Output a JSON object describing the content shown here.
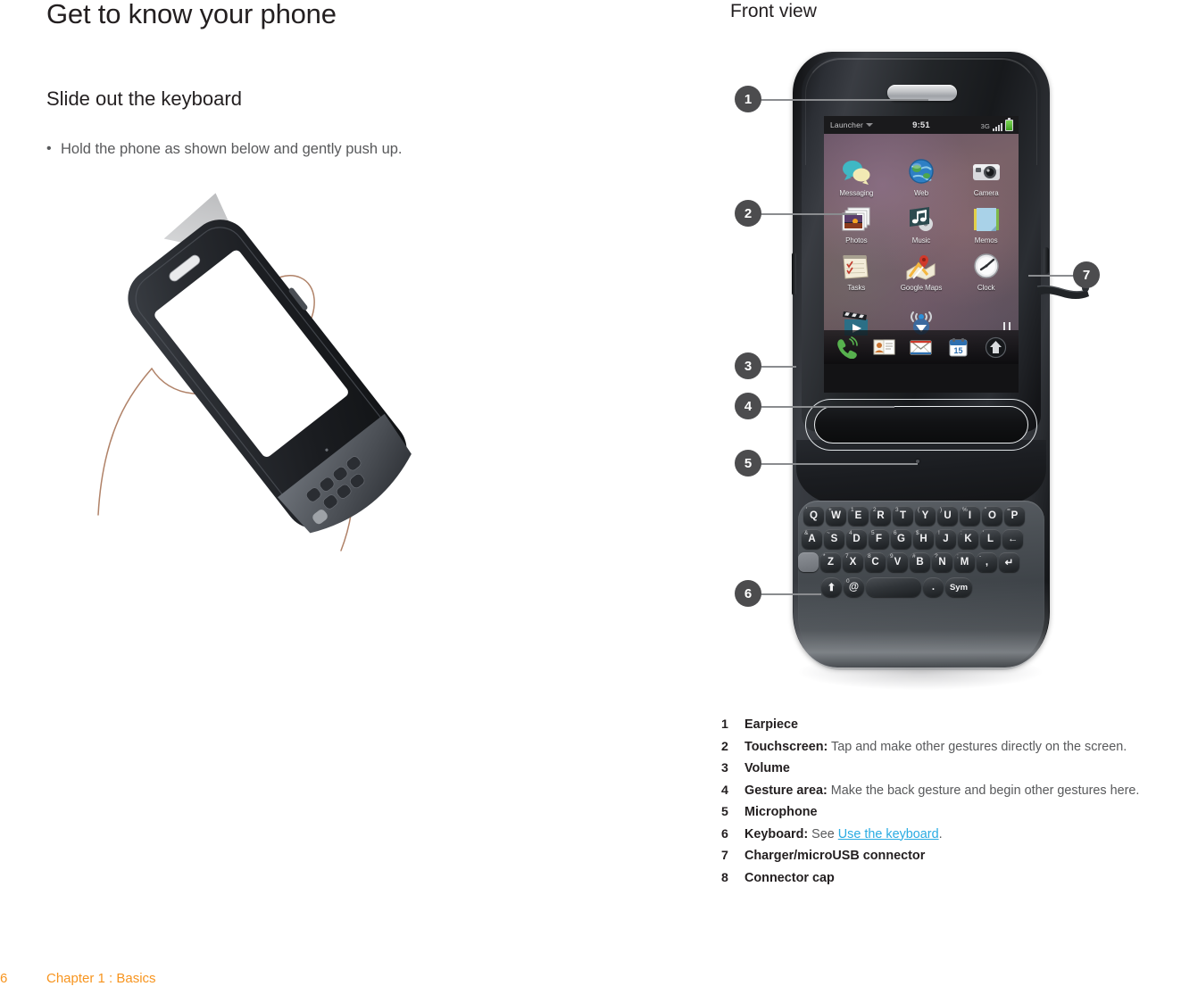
{
  "document": {
    "page_title": "Get to know your phone",
    "section_title": "Slide out the keyboard",
    "bullet_marker": "•",
    "bullet_text": "Hold the phone as shown below and gently push up."
  },
  "right": {
    "front_view_title": "Front view"
  },
  "phone_screen": {
    "statusbar": {
      "launcher_label": "Launcher",
      "time": "9:51",
      "network": "3G",
      "signal_icon": "signal-bars-icon",
      "battery_icon": "battery-icon"
    },
    "apps": [
      {
        "label": "Messaging",
        "icon": "messaging-icon"
      },
      {
        "label": "Web",
        "icon": "web-globe-icon"
      },
      {
        "label": "Camera",
        "icon": "camera-icon"
      },
      {
        "label": "Photos",
        "icon": "photos-icon"
      },
      {
        "label": "Music",
        "icon": "music-icon"
      },
      {
        "label": "Memos",
        "icon": "memos-icon"
      },
      {
        "label": "Tasks",
        "icon": "tasks-icon"
      },
      {
        "label": "Google Maps",
        "icon": "google-maps-icon"
      },
      {
        "label": "Clock",
        "icon": "clock-icon"
      }
    ],
    "partial_row": [
      {
        "label": "",
        "icon": "videos-icon"
      },
      {
        "label": "",
        "icon": "wifi-sharing-icon"
      },
      {
        "label": "",
        "icon": ""
      }
    ],
    "dock": [
      {
        "icon": "phone-icon"
      },
      {
        "icon": "contacts-icon"
      },
      {
        "icon": "email-icon"
      },
      {
        "icon": "calendar-icon",
        "badge": "15"
      },
      {
        "icon": "launcher-home-icon"
      }
    ]
  },
  "keyboard": {
    "rows": [
      [
        {
          "main": "Q",
          "sup": "'"
        },
        {
          "main": "W",
          "sup": "+"
        },
        {
          "main": "E",
          "sup": "1"
        },
        {
          "main": "R",
          "sup": "2"
        },
        {
          "main": "T",
          "sup": "3"
        },
        {
          "main": "Y",
          "sup": "("
        },
        {
          "main": "U",
          "sup": ")"
        },
        {
          "main": "I",
          "sup": "%"
        },
        {
          "main": "O",
          "sup": "\""
        },
        {
          "main": "P",
          "sup": "="
        }
      ],
      [
        {
          "main": "A",
          "sup": "&"
        },
        {
          "main": "S",
          "sup": "~"
        },
        {
          "main": "D",
          "sup": "4"
        },
        {
          "main": "F",
          "sup": "5"
        },
        {
          "main": "G",
          "sup": "6"
        },
        {
          "main": "H",
          "sup": "$"
        },
        {
          "main": "J",
          "sup": "!"
        },
        {
          "main": "K",
          "sup": ":"
        },
        {
          "main": "L",
          "sup": "'"
        },
        {
          "main": "←",
          "sup": ""
        }
      ],
      [
        {
          "main": "",
          "sup": ""
        },
        {
          "main": "Z",
          "sup": "*"
        },
        {
          "main": "X",
          "sup": "7"
        },
        {
          "main": "C",
          "sup": "8"
        },
        {
          "main": "V",
          "sup": "9"
        },
        {
          "main": "B",
          "sup": "#"
        },
        {
          "main": "N",
          "sup": "?"
        },
        {
          "main": "M",
          "sup": ";"
        },
        {
          "main": ",",
          "sup": "-"
        },
        {
          "main": "↵",
          "sup": ""
        }
      ],
      [
        {
          "main": "⬆",
          "sup": ""
        },
        {
          "main": "@",
          "sup": "0"
        },
        {
          "main": "",
          "sup": ""
        },
        {
          "main": ".",
          "sup": ""
        },
        {
          "main": "Sym",
          "sup": ""
        }
      ]
    ]
  },
  "callouts": [
    {
      "num": "1"
    },
    {
      "num": "2"
    },
    {
      "num": "3"
    },
    {
      "num": "4"
    },
    {
      "num": "5"
    },
    {
      "num": "6"
    },
    {
      "num": "7"
    }
  ],
  "legend": [
    {
      "num": "1",
      "term": "Earpiece",
      "desc": "",
      "link": "",
      "tail": ""
    },
    {
      "num": "2",
      "term": "Touchscreen:",
      "desc": " Tap and make other gestures directly on the screen.",
      "link": "",
      "tail": ""
    },
    {
      "num": "3",
      "term": "Volume",
      "desc": "",
      "link": "",
      "tail": ""
    },
    {
      "num": "4",
      "term": "Gesture area:",
      "desc": " Make the back gesture and begin other gestures here.",
      "link": "",
      "tail": ""
    },
    {
      "num": "5",
      "term": "Microphone",
      "desc": "",
      "link": "",
      "tail": ""
    },
    {
      "num": "6",
      "term": "Keyboard:",
      "desc": " See ",
      "link": "Use the keyboard",
      "tail": "."
    },
    {
      "num": "7",
      "term": "Charger/microUSB connector",
      "desc": "",
      "link": "",
      "tail": ""
    },
    {
      "num": "8",
      "term": "Connector cap",
      "desc": "",
      "link": "",
      "tail": ""
    }
  ],
  "footer": {
    "page_number": "6",
    "chapter": "Chapter 1 :  Basics"
  },
  "colors": {
    "accent_orange": "#f7941e",
    "link_blue": "#29abe2",
    "body_text": "#58595b",
    "heading": "#231f20",
    "callout_bg": "#4c4c4e"
  }
}
